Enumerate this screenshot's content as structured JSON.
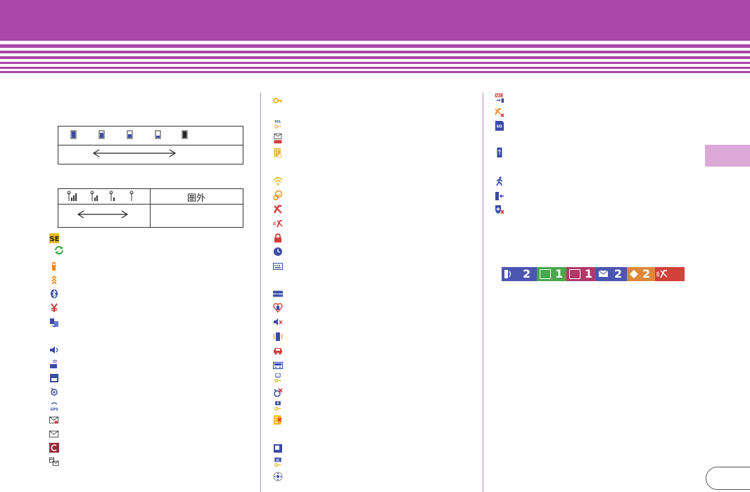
{
  "signal_table": {
    "out_of_service_label": "圏外"
  },
  "status_bar": {
    "counts": [
      "2",
      "1",
      "1",
      "2",
      "2"
    ],
    "colors": [
      "#4a56b0",
      "#49a84b",
      "#b2386a",
      "#4a56b0",
      "#e0883a",
      "#d2403a"
    ]
  },
  "colors": {
    "header": "#ab47a8",
    "side_tab": "#dca8d8",
    "blue_icon": "#3a4aa8",
    "orange_icon": "#e88a1a",
    "red_icon": "#d23c3c",
    "yellow_icon": "#e8b820",
    "green_icon": "#3aa84a",
    "maroon_icon": "#9a2a3a"
  },
  "icons": {
    "left": [
      "self-mode-icon",
      "sync-icon",
      "battery-icon",
      "charging-arrows-icon",
      "bluetooth-icon",
      "yen-icon",
      "transfer-icon",
      "speaker-icon",
      "folder-wireless-icon",
      "sim-icon",
      "gps-position-icon",
      "gps-sync-icon",
      "mail-signal-icon",
      "mail-icon",
      "c-app-icon",
      "calendar-mail-icon"
    ],
    "middle": [
      "key-icon",
      "ssl-key-icon",
      "auto-mail-icon",
      "keypad-lock-icon",
      "wifi-icon",
      "smile-icon",
      "vibrate-off-icon",
      "vibrate-sound-icon",
      "padlock-icon",
      "clock-icon",
      "keyboard-icon",
      "office-ed-icon",
      "heart-phone-icon",
      "mute-icon",
      "vibrate-icon",
      "car-icon",
      "radio-icon",
      "usb-key-icon",
      "gps-off-icon",
      "person-key-icon",
      "keypad-x-icon",
      "card-icon",
      "ic-key-icon",
      "nav-pad-icon"
    ],
    "right": [
      "rec-transfer-icon",
      "vibrate-x-icon",
      "sd-card-icon",
      "usb-icon",
      "walking-icon",
      "phone-transfer-icon",
      "shield-x-icon"
    ]
  }
}
